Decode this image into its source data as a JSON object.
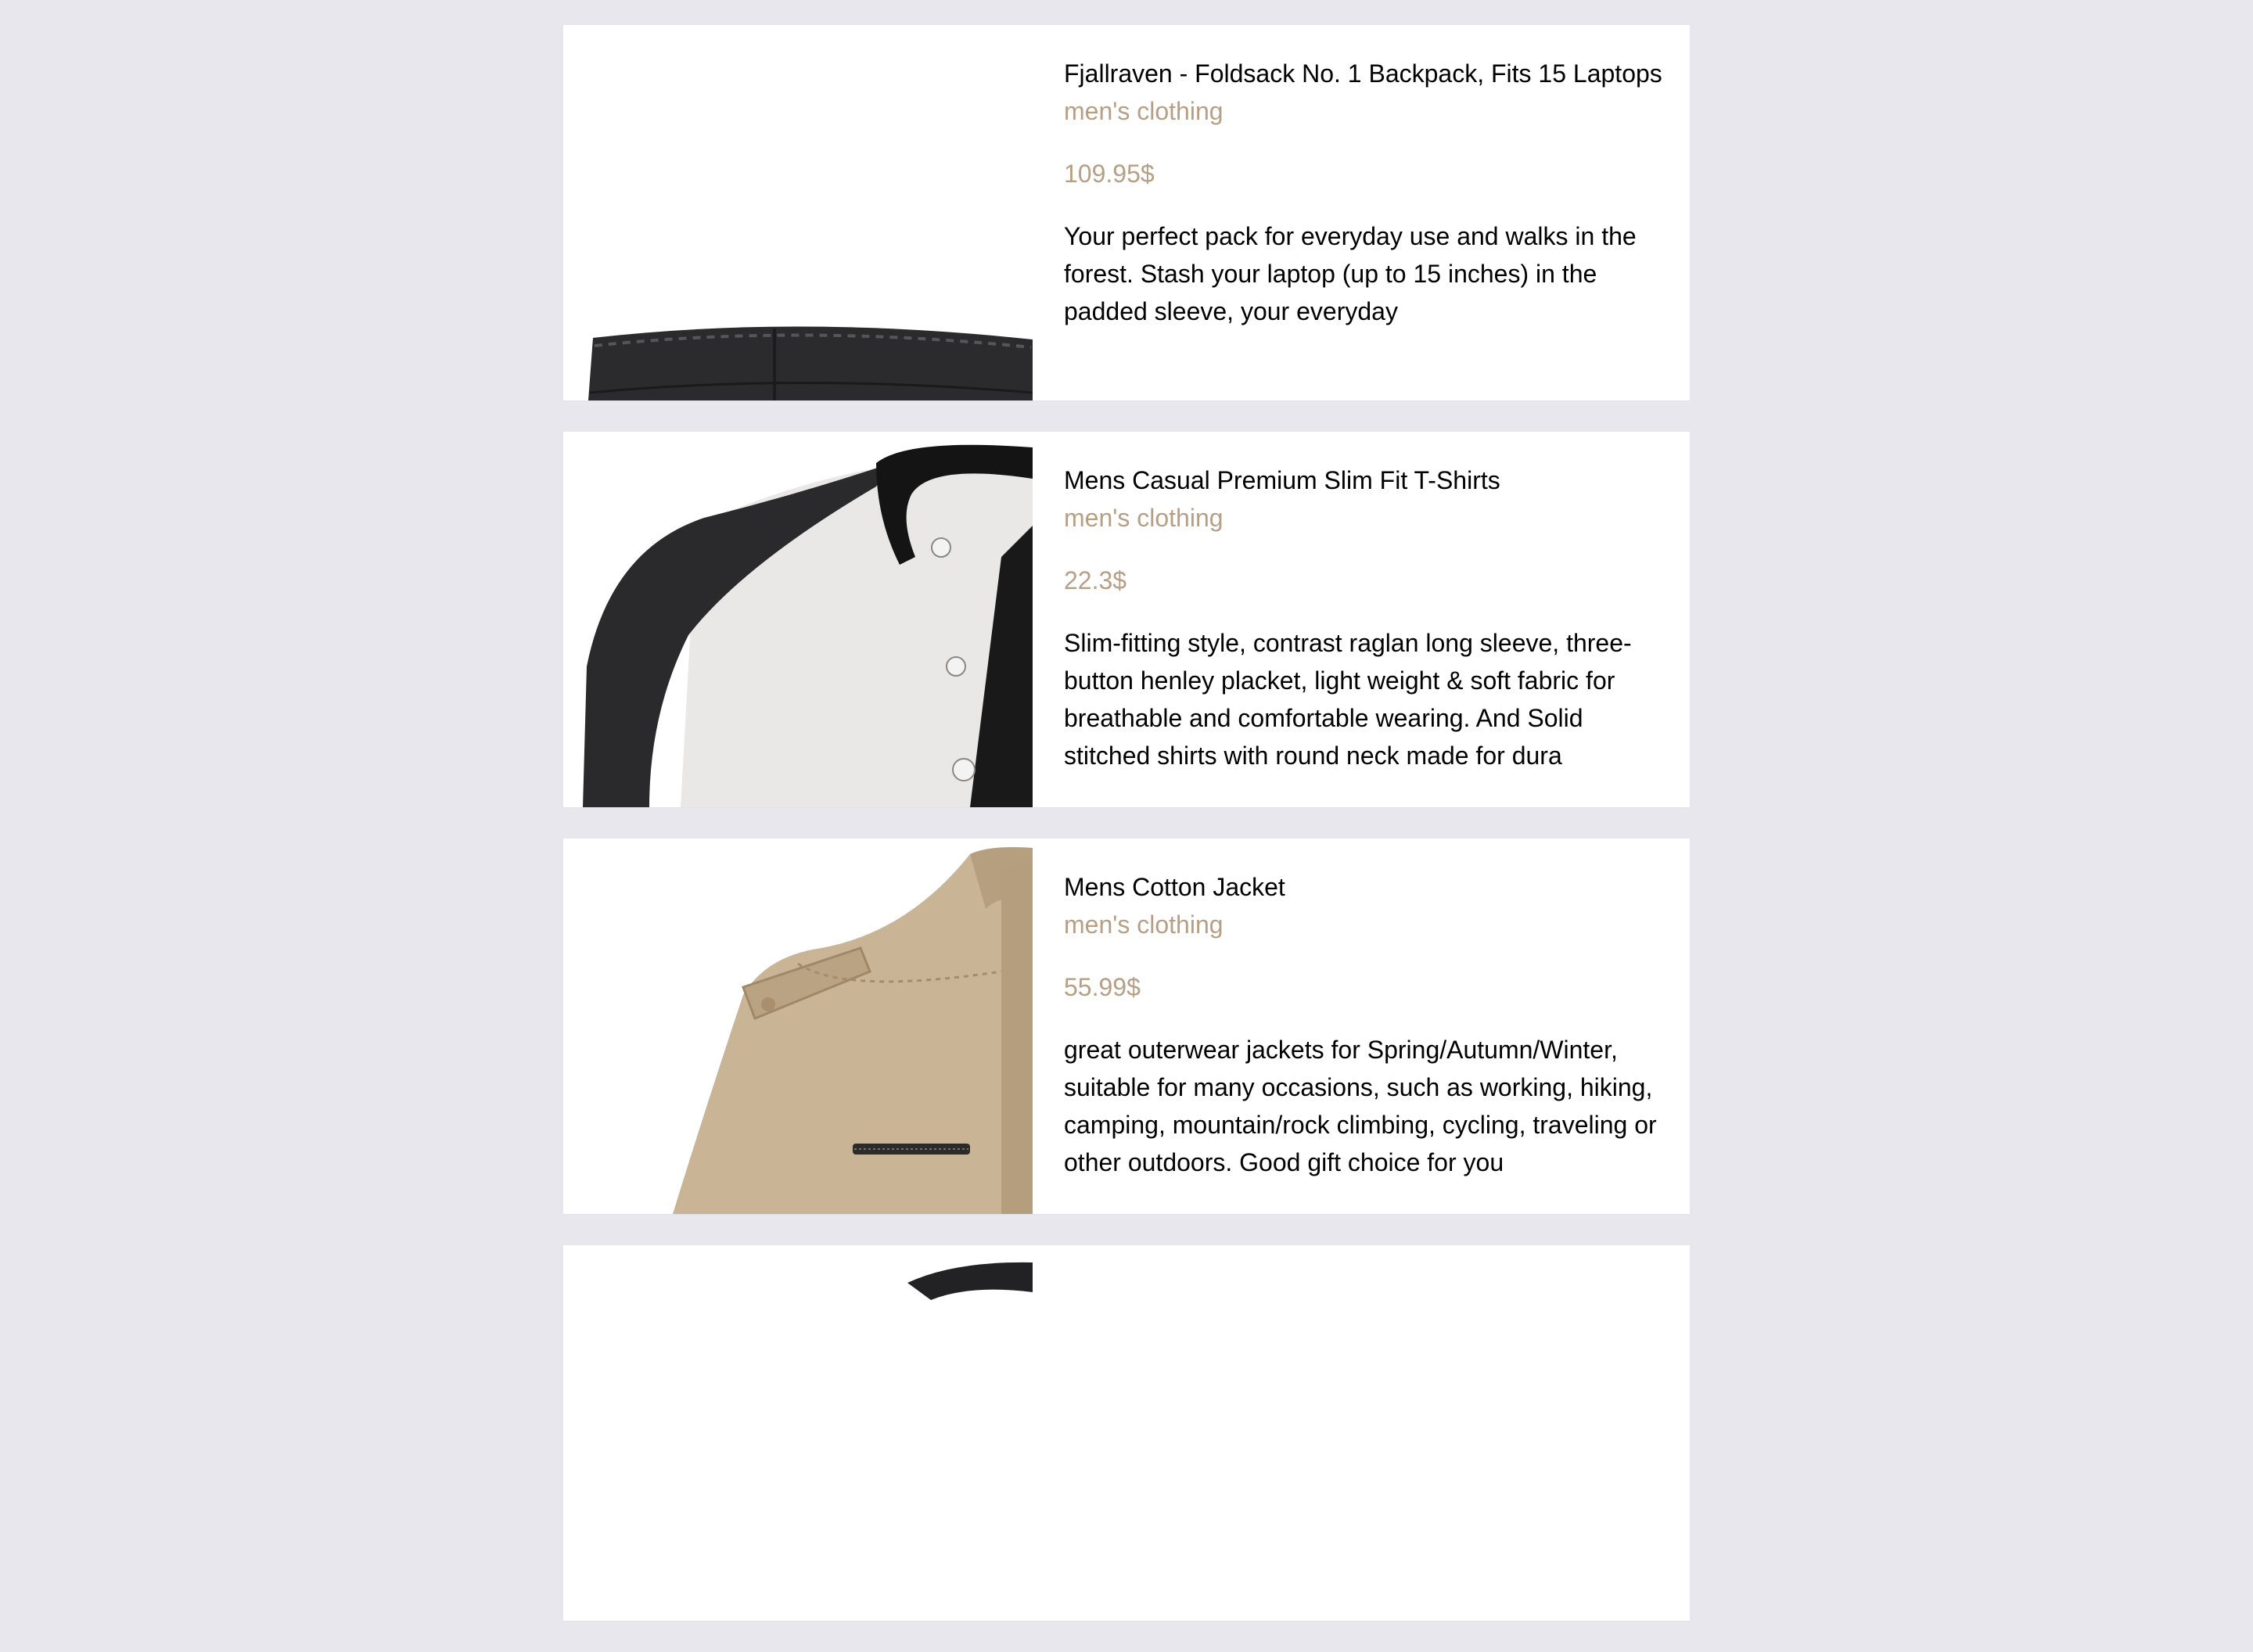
{
  "products": [
    {
      "title": "Fjallraven - Foldsack No. 1 Backpack, Fits 15 Laptops",
      "category": "men's clothing",
      "price": "109.95$",
      "description": "Your perfect pack for everyday use and walks in the forest. Stash your laptop (up to 15 inches) in the padded sleeve, your everyday",
      "image_icon": "backpack-image"
    },
    {
      "title": "Mens Casual Premium Slim Fit T-Shirts",
      "category": "men's clothing",
      "price": "22.3$",
      "description": "Slim-fitting style, contrast raglan long sleeve, three-button henley placket, light weight & soft fabric for breathable and comfortable wearing. And Solid stitched shirts with round neck made for dura",
      "image_icon": "tshirt-image"
    },
    {
      "title": "Mens Cotton Jacket",
      "category": "men's clothing",
      "price": "55.99$",
      "description": "great outerwear jackets for Spring/Autumn/Winter, suitable for many occasions, such as working, hiking, camping, mountain/rock climbing, cycling, traveling or other outdoors. Good gift choice for you",
      "image_icon": "jacket-image"
    }
  ],
  "colors": {
    "background": "#e8e7ee",
    "card": "#ffffff",
    "accent": "#b79f85",
    "text": "#000000"
  }
}
